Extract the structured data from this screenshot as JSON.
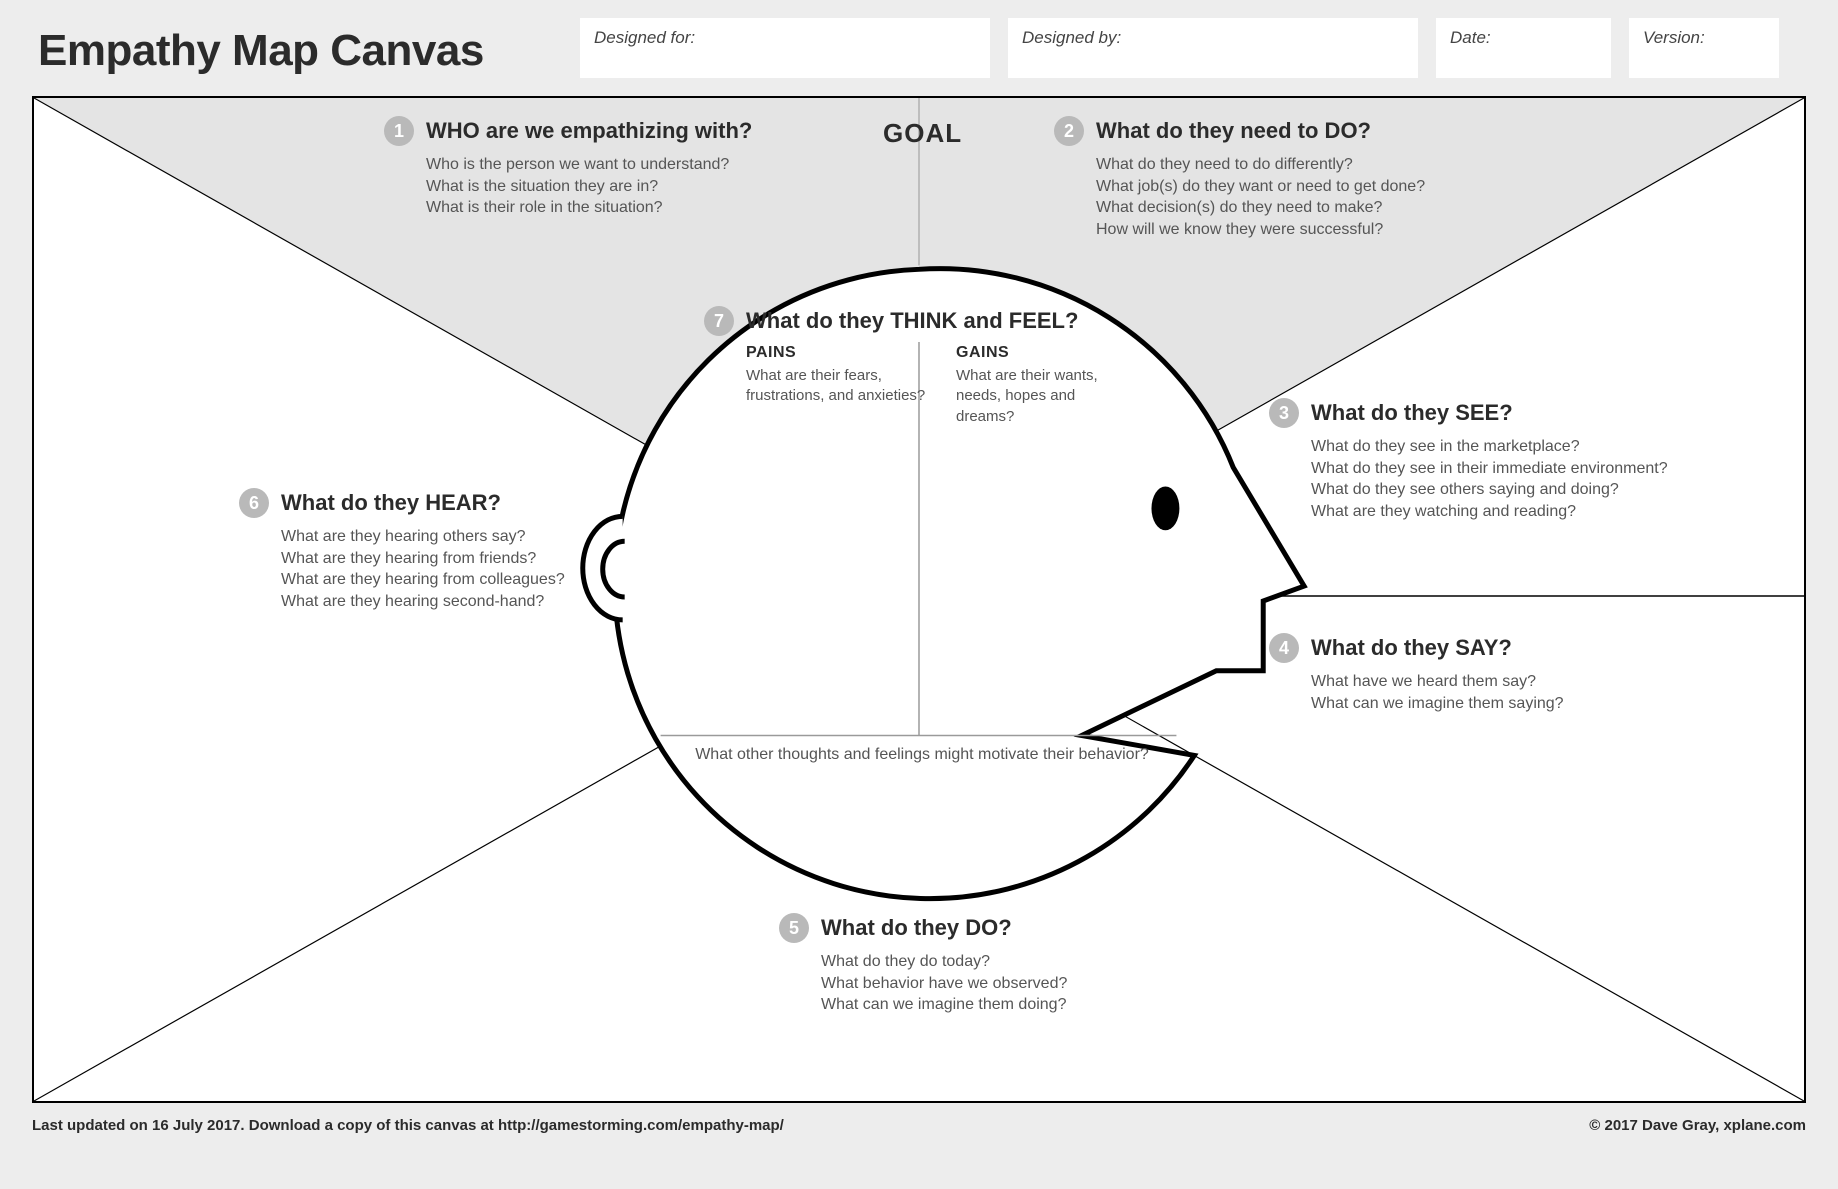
{
  "title": "Empathy Map Canvas",
  "fields": {
    "designed_for_label": "Designed for:",
    "designed_by_label": "Designed by:",
    "date_label": "Date:",
    "version_label": "Version:"
  },
  "goal_label": "GOAL",
  "sections": {
    "s1": {
      "num": "1",
      "title": "WHO are we empathizing with?",
      "q1": "Who is the person we want to understand?",
      "q2": "What is the situation they are in?",
      "q3": "What is their role in the situation?"
    },
    "s2": {
      "num": "2",
      "title": "What do they need to DO?",
      "q1": "What do they need to do differently?",
      "q2": "What job(s) do they want or need to get done?",
      "q3": "What decision(s) do they need to make?",
      "q4": "How will we know they were successful?"
    },
    "s3": {
      "num": "3",
      "title": "What do they SEE?",
      "q1": "What do they see in the marketplace?",
      "q2": "What do they see in their immediate environment?",
      "q3": "What do they see others saying and doing?",
      "q4": "What are they watching and reading?"
    },
    "s4": {
      "num": "4",
      "title": "What do they SAY?",
      "q1": "What have we heard them say?",
      "q2": "What can we imagine them saying?"
    },
    "s5": {
      "num": "5",
      "title": "What do they DO?",
      "q1": "What do they do today?",
      "q2": "What behavior have we observed?",
      "q3": "What can we imagine them doing?"
    },
    "s6": {
      "num": "6",
      "title": "What do they HEAR?",
      "q1": "What are they hearing others say?",
      "q2": "What are they hearing from friends?",
      "q3": "What are they hearing from colleagues?",
      "q4": "What are they hearing second-hand?"
    },
    "s7": {
      "num": "7",
      "title": "What do they THINK and FEEL?",
      "pains_label": "PAINS",
      "pains_q": "What are their fears, frustrations, and anxieties?",
      "gains_label": "GAINS",
      "gains_q": "What are their wants, needs, hopes and dreams?",
      "center_q": "What other thoughts and feelings might motivate their behavior?"
    }
  },
  "footer": {
    "left": "Last updated on 16 July 2017. Download a copy of this canvas at http://gamestorming.com/empathy-map/",
    "right": "© 2017 Dave Gray, xplane.com"
  }
}
